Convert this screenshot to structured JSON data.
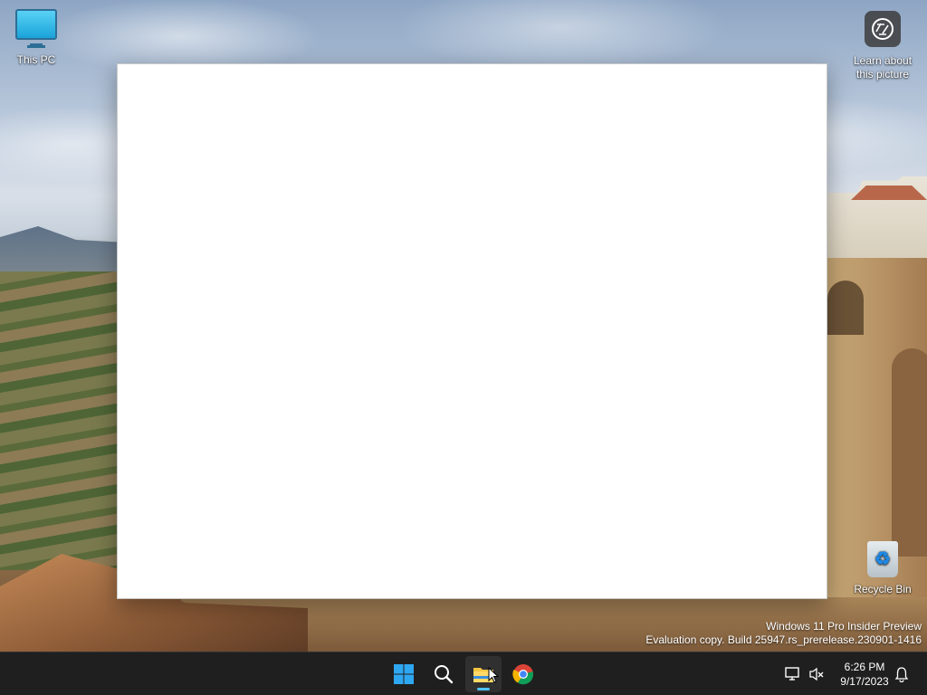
{
  "desktop": {
    "icons": {
      "this_pc": "This PC",
      "learn_about": "Learn about this picture",
      "recycle_bin": "Recycle Bin"
    }
  },
  "watermark": {
    "line1": "Windows 11 Pro Insider Preview",
    "line2": "Evaluation copy. Build 25947.rs_prerelease.230901-1416"
  },
  "taskbar": {
    "apps": [
      "start",
      "search",
      "file-explorer",
      "chrome"
    ],
    "active_app": "file-explorer",
    "clock": {
      "time": "6:26 PM",
      "date": "9/17/2023"
    }
  },
  "colors": {
    "taskbar_bg": "#1f1f1f",
    "accent": "#4cc2ff"
  }
}
